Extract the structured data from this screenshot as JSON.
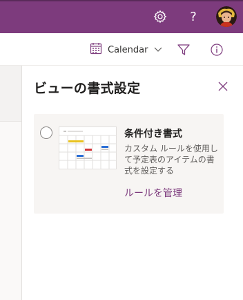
{
  "topbar": {
    "settings_icon": "gear-icon",
    "help_label": "?",
    "avatar_icon": "user-avatar"
  },
  "commandbar": {
    "calendar_label": "Calendar",
    "calendar_icon": "calendar-icon",
    "chevron_icon": "chevron-down-icon",
    "filter_icon": "filter-icon",
    "info_icon": "info-icon"
  },
  "panel": {
    "title": "ビューの書式設定",
    "close_icon": "close-icon",
    "option": {
      "title": "条件付き書式",
      "description": "カスタム ルールを使用して予定表のアイテムの書式を設定する",
      "link": "ルールを管理",
      "selected": false
    }
  },
  "colors": {
    "brand": "#7d3b7d",
    "card_bg": "#f7f5f3",
    "event_yellow": "#e8c21f",
    "event_red": "#d13438",
    "event_blue": "#2b6fd6"
  }
}
